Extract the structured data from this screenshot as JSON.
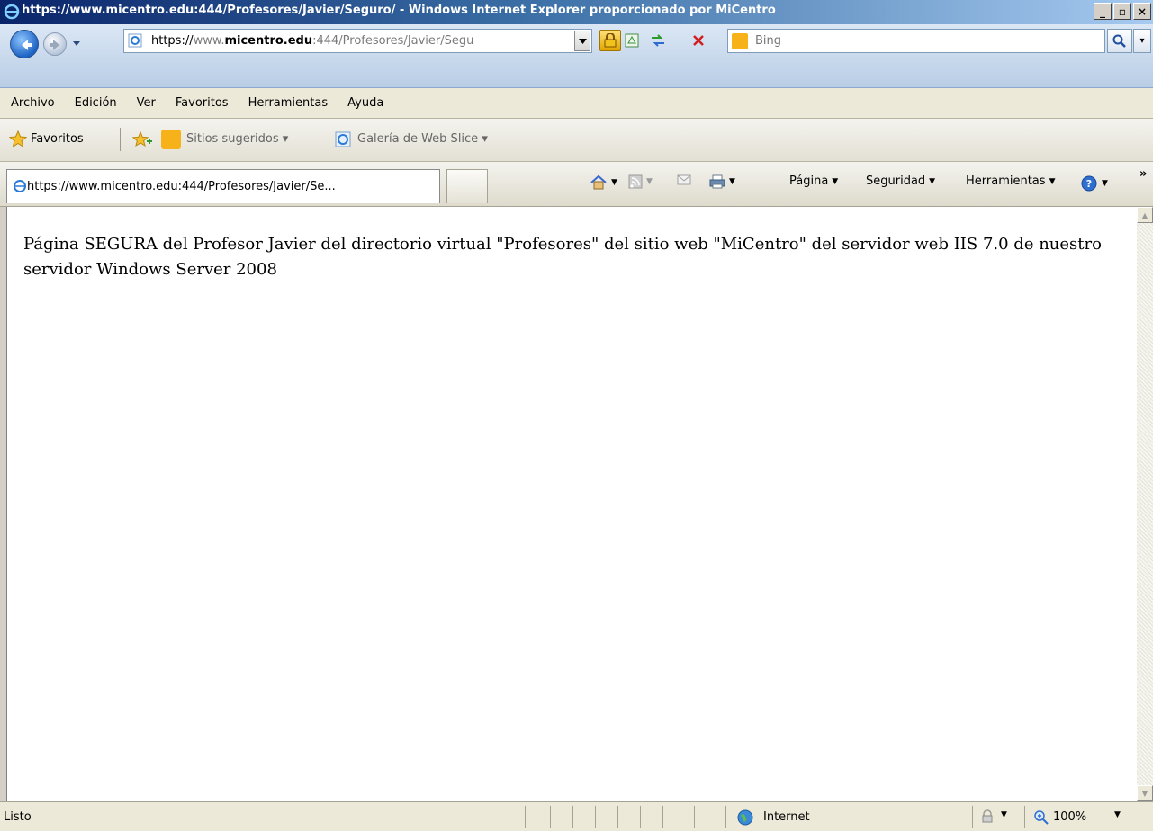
{
  "window": {
    "title": "https://www.micentro.edu:444/Profesores/Javier/Seguro/ - Windows Internet Explorer proporcionado por MiCentro",
    "minimize": "_",
    "restore": "▫",
    "close": "×"
  },
  "address": {
    "host_prefix": "https://",
    "host_dim": "www.",
    "host_bold": "micentro.edu",
    "path": ":444/Profesores/Javier/Segu"
  },
  "search": {
    "placeholder": "Bing"
  },
  "menu": [
    "Archivo",
    "Edición",
    "Ver",
    "Favoritos",
    "Herramientas",
    "Ayuda"
  ],
  "favorites": {
    "label": "Favoritos",
    "suggested": "Sitios sugeridos ▾",
    "webslice": "Galería de Web Slice ▾"
  },
  "tab": {
    "title": "https://www.micentro.edu:444/Profesores/Javier/Se..."
  },
  "commands": {
    "page": "Página",
    "security": "Seguridad",
    "tools": "Herramientas",
    "more": "»"
  },
  "page": {
    "body": "Página SEGURA del Profesor Javier del directorio virtual \"Profesores\" del sitio web \"MiCentro\" del servidor web IIS 7.0 de nuestro servidor Windows Server 2008"
  },
  "status": {
    "text": "Listo",
    "zone": "Internet",
    "zoom": "100%"
  },
  "colors": {
    "titlebar_start": "#0a246a",
    "titlebar_end": "#a6caf0",
    "chrome": "#ece9d8"
  }
}
